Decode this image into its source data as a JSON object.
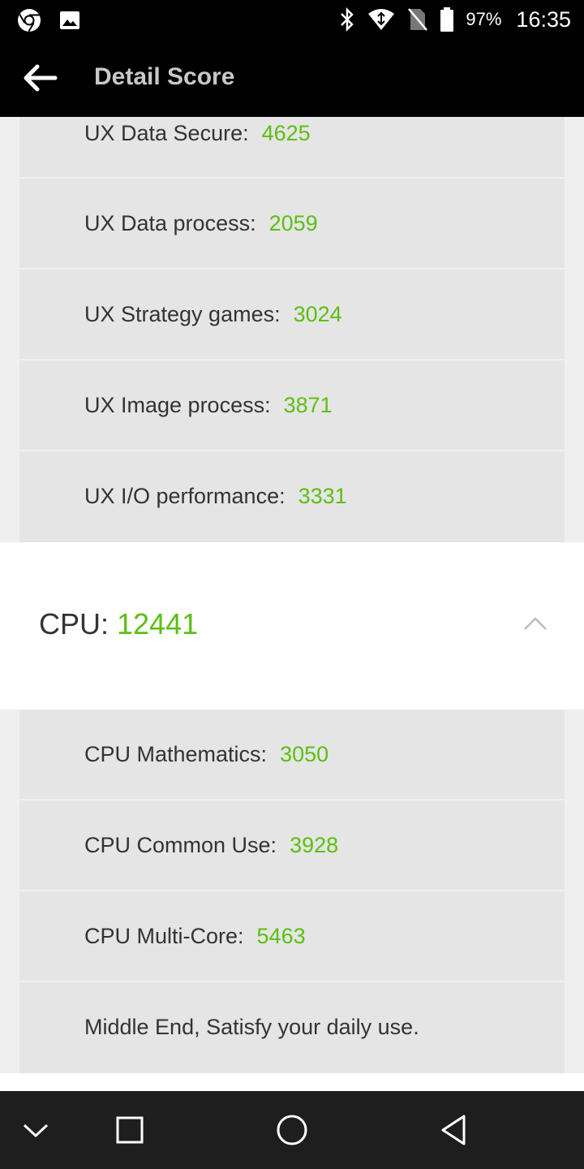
{
  "status_bar": {
    "battery_percent": "97%",
    "time": "16:35",
    "icons": [
      "chrome-icon",
      "gallery-icon",
      "bluetooth-icon",
      "wifi-icon",
      "no-sim-icon",
      "battery-icon"
    ]
  },
  "app_bar": {
    "title": "Detail Score"
  },
  "ux_items": [
    {
      "label": "UX Data Secure:",
      "value": "4625"
    },
    {
      "label": "UX Data process:",
      "value": "2059"
    },
    {
      "label": "UX Strategy games:",
      "value": "3024"
    },
    {
      "label": "UX Image process:",
      "value": "3871"
    },
    {
      "label": "UX I/O performance:",
      "value": "3331"
    }
  ],
  "cpu_section": {
    "title": "CPU:",
    "score": "12441",
    "expanded": true,
    "items": [
      {
        "label": "CPU Mathematics:",
        "value": "3050"
      },
      {
        "label": "CPU Common Use:",
        "value": "3928"
      },
      {
        "label": "CPU Multi-Core:",
        "value": "5463"
      }
    ],
    "summary": "Middle End, Satisfy your daily use."
  },
  "colors": {
    "accent_green": "#5cbf12",
    "sub_row_bg": "#e5e5e5",
    "bar_black": "#000000",
    "nav_bar": "#1e1e1e"
  },
  "nav_bar": {
    "icons": [
      "chevron-down-icon",
      "recents-icon",
      "home-icon",
      "back-triangle-icon"
    ]
  }
}
